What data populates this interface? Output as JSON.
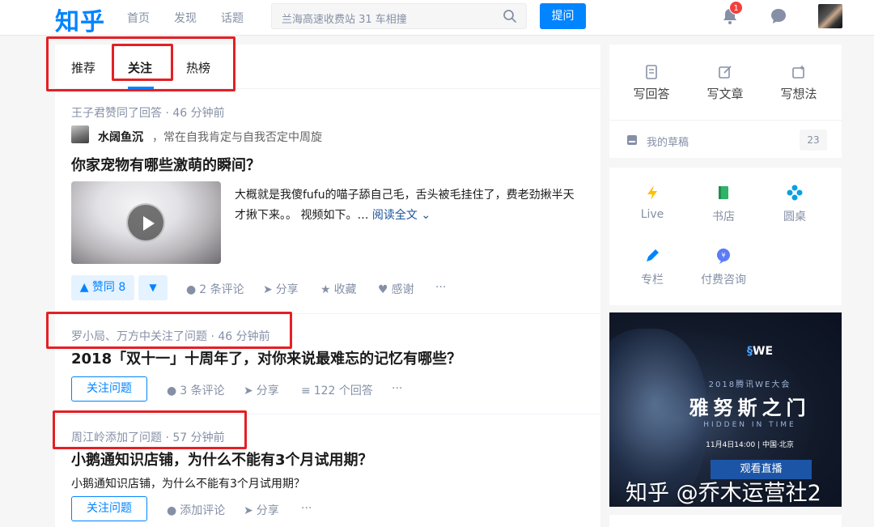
{
  "header": {
    "logo": "知乎",
    "nav": [
      "首页",
      "发现",
      "话题"
    ],
    "search_placeholder": "兰海高速收费站 31 车相撞",
    "ask_label": "提问",
    "notification_count": "1"
  },
  "tabs": [
    "推荐",
    "关注",
    "热榜"
  ],
  "feed": {
    "item1": {
      "meta": "王子君赞同了回答 · 46 分钟前",
      "author_name": "水阔鱼沉",
      "author_bio": "，常在自我肯定与自我否定中周旋",
      "title": "你家宠物有哪些激萌的瞬间？",
      "excerpt": "大概就是我傻fufu的喵子舔自己毛，舌头被毛挂住了，费老劲揪半天才揪下来。。 视频如下。…",
      "read_more": "阅读全文",
      "vote_label": "▲ 赞同 8",
      "actions": [
        "2 条评论",
        "分享",
        "收藏",
        "感谢",
        "···"
      ]
    },
    "item2": {
      "meta": "罗小局、万方中关注了问题 · 46 分钟前",
      "title": "2018「双十一」十周年了，对你来说最难忘的记忆有哪些？",
      "follow_label": "关注问题",
      "actions": [
        "3 条评论",
        "分享",
        "122 个回答",
        "···"
      ]
    },
    "item3": {
      "meta": "周江岭添加了问题 · 57 分钟前",
      "title": "小鹅通知识店铺，为什么不能有3个月试用期？",
      "excerpt": "小鹅通知识店铺，为什么不能有3个月试用期？",
      "follow_label": "关注问题",
      "actions": [
        "添加评论",
        "分享",
        "···"
      ]
    }
  },
  "sidebar": {
    "write_actions": [
      "写回答",
      "写文章",
      "写想法"
    ],
    "draft_label": "我的草稿",
    "draft_count": "23",
    "services": [
      "Live",
      "书店",
      "圆桌",
      "专栏",
      "付费咨询"
    ],
    "ad": {
      "logo": "WE",
      "event": "2018腾讯WE大会",
      "headline": "雅努斯之门",
      "english": "HIDDEN IN TIME",
      "date": "11月4日14:00 | 中国·北京",
      "cta": "观看直播"
    }
  },
  "watermark": "知乎 @乔木运营社2",
  "colors": {
    "accent": "#0084ff",
    "highlight_box": "#e42024"
  }
}
